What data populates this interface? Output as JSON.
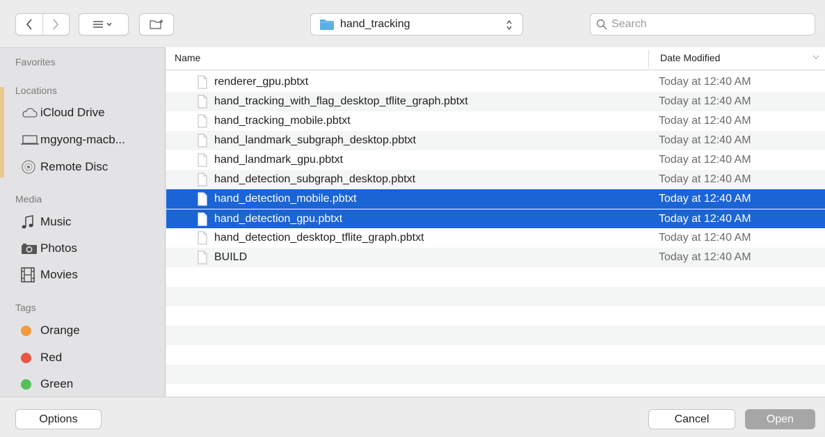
{
  "toolbar": {
    "back_icon": "chevron-left-icon",
    "forward_icon": "chevron-right-icon",
    "view_icon": "list-view-icon",
    "new_folder_icon": "new-folder-icon",
    "path_folder": "hand_tracking",
    "search_placeholder": "Search"
  },
  "sidebar": {
    "sections": {
      "favorites": "Favorites",
      "locations": "Locations",
      "media": "Media",
      "tags": "Tags"
    },
    "locations": [
      {
        "label": "iCloud Drive",
        "icon": "cloud-icon"
      },
      {
        "label": "mgyong-macb...",
        "icon": "laptop-icon"
      },
      {
        "label": "Remote Disc",
        "icon": "disc-icon"
      }
    ],
    "media": [
      {
        "label": "Music",
        "icon": "music-note-icon"
      },
      {
        "label": "Photos",
        "icon": "camera-icon"
      },
      {
        "label": "Movies",
        "icon": "film-icon"
      }
    ],
    "tags": [
      {
        "label": "Orange",
        "color": "#f19a3e"
      },
      {
        "label": "Red",
        "color": "#eb5545"
      },
      {
        "label": "Green",
        "color": "#55c058"
      }
    ]
  },
  "list": {
    "columns": {
      "name": "Name",
      "date": "Date Modified"
    },
    "files": [
      {
        "name": "renderer_gpu.pbtxt",
        "date": "Today at 12:40 AM",
        "selected": false
      },
      {
        "name": "hand_tracking_with_flag_desktop_tflite_graph.pbtxt",
        "date": "Today at 12:40 AM",
        "selected": false
      },
      {
        "name": "hand_tracking_mobile.pbtxt",
        "date": "Today at 12:40 AM",
        "selected": false
      },
      {
        "name": "hand_landmark_subgraph_desktop.pbtxt",
        "date": "Today at 12:40 AM",
        "selected": false
      },
      {
        "name": "hand_landmark_gpu.pbtxt",
        "date": "Today at 12:40 AM",
        "selected": false
      },
      {
        "name": "hand_detection_subgraph_desktop.pbtxt",
        "date": "Today at 12:40 AM",
        "selected": false
      },
      {
        "name": "hand_detection_mobile.pbtxt",
        "date": "Today at 12:40 AM",
        "selected": true
      },
      {
        "name": "hand_detection_gpu.pbtxt",
        "date": "Today at 12:40 AM",
        "selected": true
      },
      {
        "name": "hand_detection_desktop_tflite_graph.pbtxt",
        "date": "Today at 12:40 AM",
        "selected": false
      },
      {
        "name": "BUILD",
        "date": "Today at 12:40 AM",
        "selected": false
      }
    ]
  },
  "footer": {
    "options_label": "Options",
    "cancel_label": "Cancel",
    "open_label": "Open"
  },
  "colors": {
    "selection": "#1a64d6",
    "open_disabled": "#a6a6a6"
  }
}
